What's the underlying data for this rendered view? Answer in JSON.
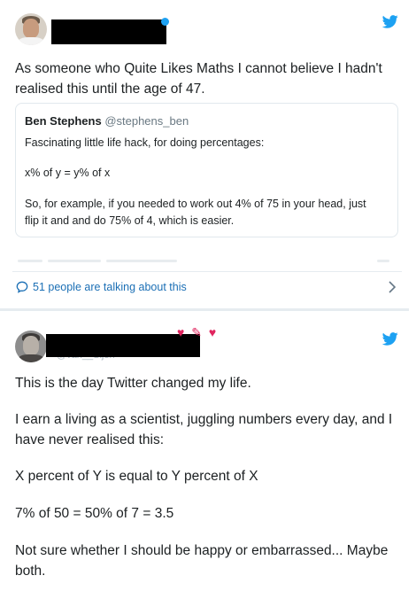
{
  "tweet1": {
    "text_lines": [
      "As someone who Quite Likes Maths I cannot believe I hadn't",
      "realised this until the age of 47."
    ],
    "quote": {
      "author_name": "Ben Stephens",
      "author_handle": "@stephens_ben",
      "line1": "Fascinating little life hack, for doing percentages:",
      "line2": "x% of y = y% of x",
      "line3a": "So, for example, if you needed to work out 4% of 75 in your head, just",
      "line3b": "flip it and and do 75% of 4, which is easier."
    },
    "talking_label": "51 people are talking about this"
  },
  "tweet2": {
    "handle_partial": "@van__Sijen",
    "decoration": "♥ ✎ ♥",
    "lines": [
      "This is the day Twitter changed my life.",
      "I earn a living as a scientist, juggling numbers every day, and I",
      "have never realised this:",
      "X percent of Y is equal to Y percent of X",
      "7% of 50 = 50% of 7 = 3.5",
      "Not sure whether I should be happy or embarrassed... Maybe",
      "both."
    ]
  },
  "colors": {
    "twitter_blue": "#1da1f2",
    "link_blue": "#1b6fb5"
  }
}
